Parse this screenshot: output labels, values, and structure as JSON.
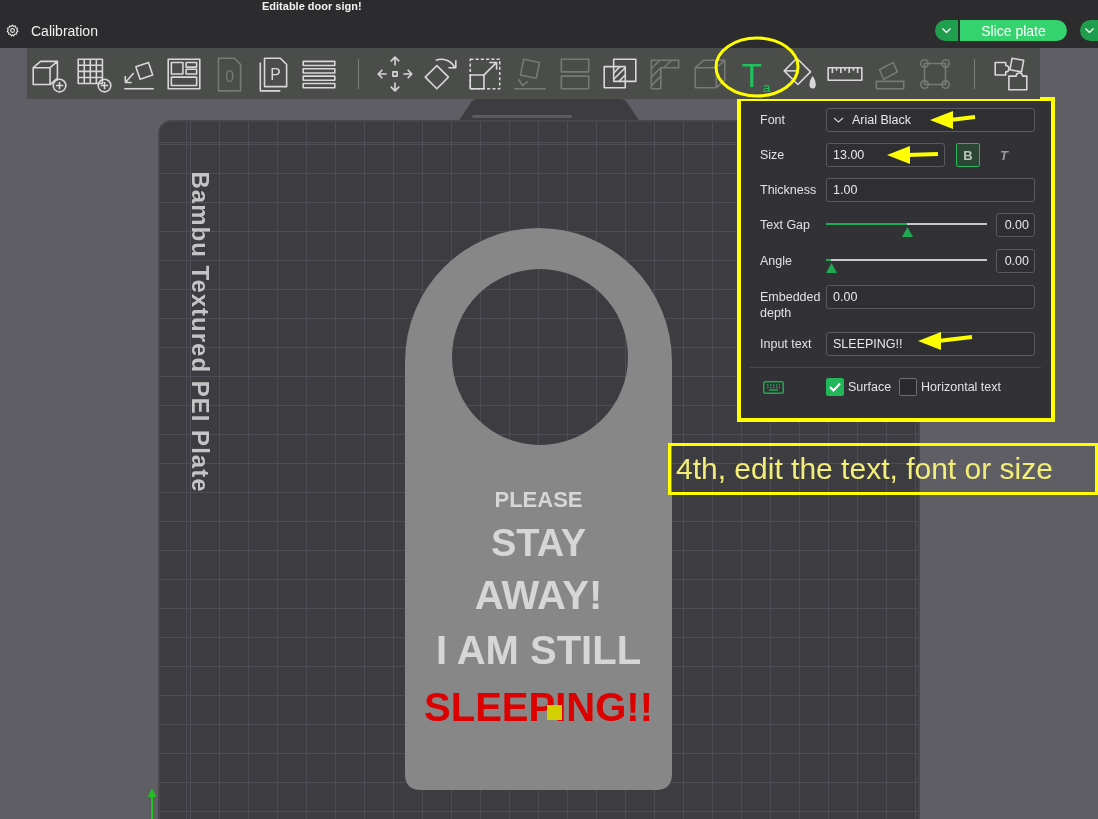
{
  "window": {
    "title": "Editable door sign!"
  },
  "top_bar": {
    "tab": {
      "label": "Calibration"
    },
    "slice_button": {
      "label": "Slice plate"
    }
  },
  "toolbar": {
    "groups": [
      {
        "tools": [
          {
            "kind": "add-cube",
            "selected": false,
            "disabled": false
          },
          {
            "kind": "add-plate",
            "selected": false,
            "disabled": false
          },
          {
            "kind": "auto-orient",
            "selected": false,
            "disabled": false
          },
          {
            "kind": "arrange",
            "selected": false,
            "disabled": false
          },
          {
            "kind": "plate-zero",
            "glyph": "0",
            "selected": false,
            "disabled": true
          },
          {
            "kind": "plate-p",
            "glyph": "P",
            "selected": false,
            "disabled": false
          },
          {
            "kind": "layers",
            "selected": false,
            "disabled": false
          }
        ]
      },
      {
        "tools": [
          {
            "kind": "move",
            "selected": false,
            "disabled": false
          },
          {
            "kind": "rotate",
            "selected": false,
            "disabled": false
          },
          {
            "kind": "scale",
            "selected": false,
            "disabled": false
          },
          {
            "kind": "lay-flat",
            "selected": false,
            "disabled": true
          },
          {
            "kind": "split",
            "selected": false,
            "disabled": true
          },
          {
            "kind": "boolean",
            "selected": false,
            "disabled": false
          },
          {
            "kind": "cut",
            "selected": false,
            "disabled": true
          },
          {
            "kind": "cube",
            "selected": false,
            "disabled": true
          },
          {
            "kind": "text",
            "glyph": "T",
            "sub_glyph": "a",
            "selected": true,
            "disabled": false
          },
          {
            "kind": "paint",
            "selected": false,
            "disabled": false
          },
          {
            "kind": "ruler",
            "selected": false,
            "disabled": false
          },
          {
            "kind": "assembly",
            "selected": false,
            "disabled": true
          },
          {
            "kind": "frame",
            "selected": false,
            "disabled": true
          }
        ]
      },
      {
        "tools": [
          {
            "kind": "puzzle",
            "selected": false,
            "disabled": false
          }
        ]
      }
    ]
  },
  "plate": {
    "label": "Bambu Textured PEI Plate",
    "model": {
      "lines": [
        {
          "text": "PLEASE",
          "selected": false
        },
        {
          "text": "STAY",
          "selected": false
        },
        {
          "text": "AWAY!",
          "selected": false
        },
        {
          "text": "I AM STILL",
          "selected": false
        },
        {
          "text": "SLEEPING!!",
          "selected": true
        }
      ]
    }
  },
  "text_panel": {
    "rows": [
      {
        "kind": "dropdown",
        "label": "Font",
        "value": "Arial Black"
      },
      {
        "kind": "size",
        "label": "Size",
        "value": "13.00",
        "styles": [
          {
            "kind": "bold",
            "label": "B",
            "selected": true
          },
          {
            "kind": "italic",
            "label": "T",
            "selected": false
          }
        ]
      },
      {
        "kind": "field",
        "label": "Thickness",
        "value": "1.00"
      },
      {
        "kind": "slider",
        "label": "Text Gap",
        "level": 0.5,
        "value": "0.00"
      },
      {
        "kind": "slider",
        "label": "Angle",
        "level": 0.03,
        "value": "0.00"
      },
      {
        "kind": "field",
        "label": "Embedded depth",
        "value": "0.00"
      },
      {
        "kind": "field",
        "label": "Input text",
        "value": "SLEEPING!!"
      }
    ],
    "options": [
      {
        "label": "Surface",
        "checked": true
      },
      {
        "label": "Horizontal text",
        "checked": false
      }
    ]
  },
  "annotation": {
    "caption": "4th, edit the text, font or size"
  }
}
